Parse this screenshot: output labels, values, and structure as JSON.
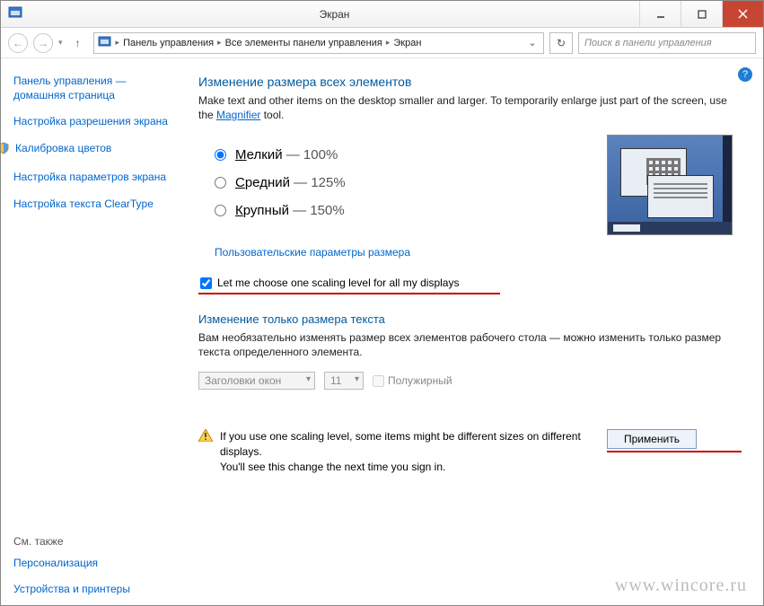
{
  "titlebar": {
    "title": "Экран"
  },
  "breadcrumb": {
    "seg1": "Панель управления",
    "seg2": "Все элементы панели управления",
    "seg3": "Экран"
  },
  "search": {
    "placeholder": "Поиск в панели управления"
  },
  "sidebar": {
    "home": "Панель управления — домашняя страница",
    "resolution": "Настройка разрешения экрана",
    "calibration": "Калибровка цветов",
    "params": "Настройка параметров экрана",
    "cleartype": "Настройка текста ClearType",
    "seealso_hdr": "См. также",
    "personalization": "Персонализация",
    "devices": "Устройства и принтеры"
  },
  "main": {
    "heading": "Изменение размера всех элементов",
    "desc_pre": "Make text and other items on the desktop smaller and larger. To temporarily enlarge just part of the screen, use the ",
    "magnifier": "Magnifier",
    "desc_post": " tool.",
    "size_small_u": "М",
    "size_small_rest": "елкий",
    "size_small_pct": " — 100%",
    "size_med_u": "С",
    "size_med_rest": "редний",
    "size_med_pct": " — 125%",
    "size_large_u": "К",
    "size_large_rest": "рупный",
    "size_large_pct": " — 150%",
    "custom_link": "Пользовательские параметры размера",
    "chk_onescale": "Let me choose one scaling level for all my displays",
    "text_heading": "Изменение только размера текста",
    "text_desc": "Вам необязательно изменять размер всех элементов рабочего стола — можно изменить только размер текста определенного элемента.",
    "dropdown_title": "Заголовки окон",
    "dropdown_size": "11",
    "bold_label": "Полужирный",
    "notice_line1": "If you use one scaling level, some items might be different sizes on different displays.",
    "notice_line2": "You'll see this change the next time you sign in.",
    "apply": "Применить"
  },
  "watermark": "www.wincore.ru"
}
